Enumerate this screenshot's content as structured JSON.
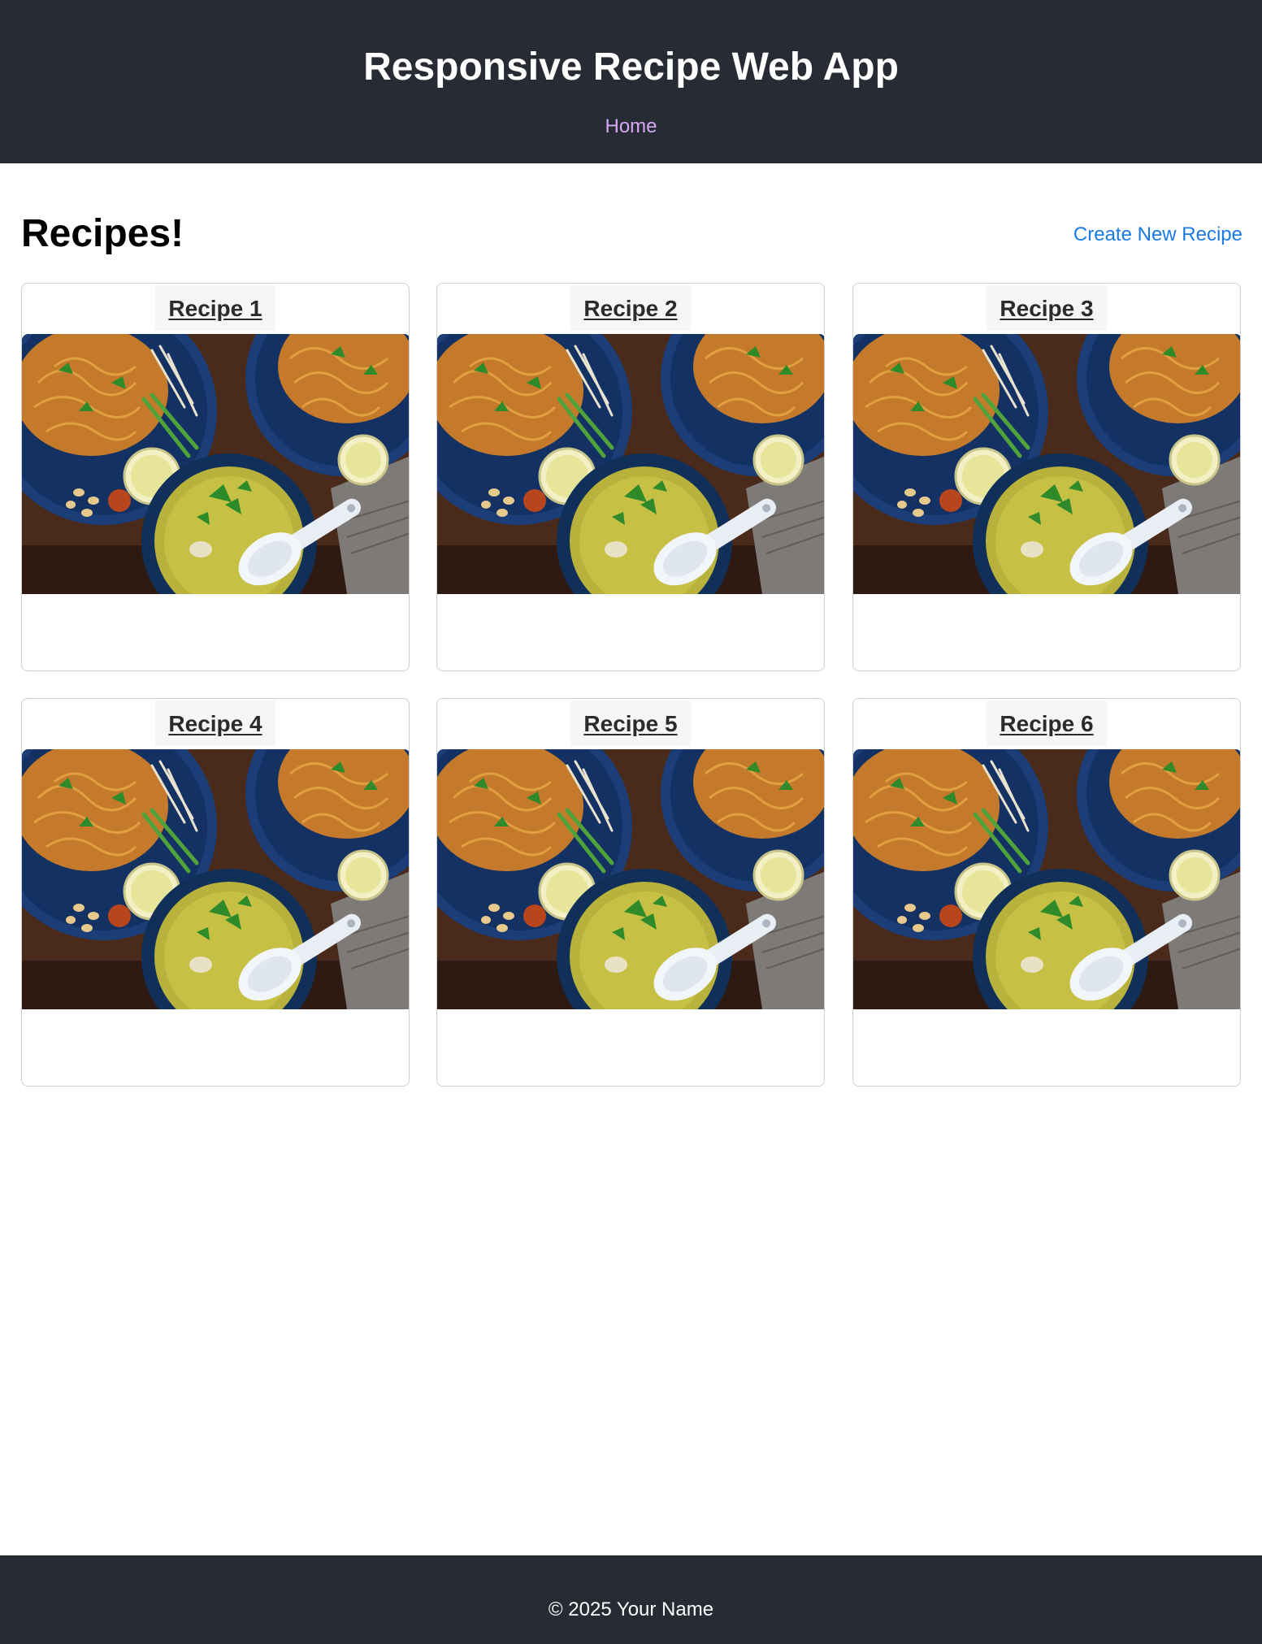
{
  "header": {
    "title": "Responsive Recipe Web App",
    "nav": {
      "home_label": "Home"
    }
  },
  "main": {
    "heading": "Recipes!",
    "create_label": "Create New Recipe",
    "recipes": [
      {
        "title": "Recipe 1",
        "image": "thai-noodle-bowls-photo"
      },
      {
        "title": "Recipe 2",
        "image": "thai-noodle-bowls-photo"
      },
      {
        "title": "Recipe 3",
        "image": "thai-noodle-bowls-photo"
      },
      {
        "title": "Recipe 4",
        "image": "thai-noodle-bowls-photo"
      },
      {
        "title": "Recipe 5",
        "image": "thai-noodle-bowls-photo"
      },
      {
        "title": "Recipe 6",
        "image": "thai-noodle-bowls-photo"
      }
    ]
  },
  "footer": {
    "text": "© 2025 Your Name"
  },
  "colors": {
    "header_bg": "#272b33",
    "nav_link": "#d7a8f5",
    "accent_link": "#1a7ae6",
    "card_border": "#cfcfcf"
  }
}
